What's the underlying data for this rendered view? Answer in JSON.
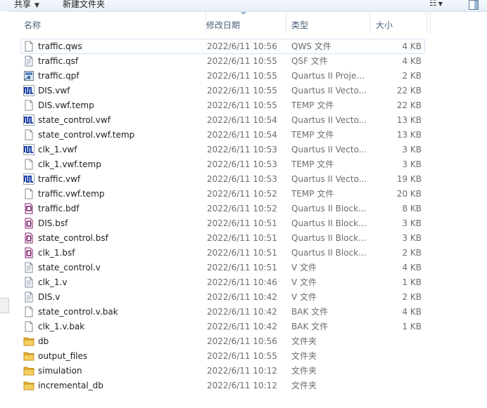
{
  "toolbar": {
    "share_label": "共享",
    "new_folder_label": "新建文件夹",
    "view_icon": "view-options-icon",
    "pane_icon": "preview-pane-icon"
  },
  "columns": {
    "name": "名称",
    "date": "修改日期",
    "type": "类型",
    "size": "大小"
  },
  "files": [
    {
      "name": "traffic.qws",
      "date": "2022/6/11 10:56",
      "type": "QWS 文件",
      "size": "4 KB",
      "icon": "blank"
    },
    {
      "name": "traffic.qsf",
      "date": "2022/6/11 10:55",
      "type": "QSF 文件",
      "size": "4 KB",
      "icon": "text"
    },
    {
      "name": "traffic.qpf",
      "date": "2022/6/11 10:55",
      "type": "Quartus II Proje...",
      "size": "2 KB",
      "icon": "project"
    },
    {
      "name": "DIS.vwf",
      "date": "2022/6/11 10:55",
      "type": "Quartus II Vecto...",
      "size": "22 KB",
      "icon": "waveform"
    },
    {
      "name": "DIS.vwf.temp",
      "date": "2022/6/11 10:55",
      "type": "TEMP 文件",
      "size": "22 KB",
      "icon": "blank"
    },
    {
      "name": "state_control.vwf",
      "date": "2022/6/11 10:54",
      "type": "Quartus II Vecto...",
      "size": "13 KB",
      "icon": "waveform"
    },
    {
      "name": "state_control.vwf.temp",
      "date": "2022/6/11 10:54",
      "type": "TEMP 文件",
      "size": "13 KB",
      "icon": "blank"
    },
    {
      "name": "clk_1.vwf",
      "date": "2022/6/11 10:53",
      "type": "Quartus II Vecto...",
      "size": "3 KB",
      "icon": "waveform"
    },
    {
      "name": "clk_1.vwf.temp",
      "date": "2022/6/11 10:53",
      "type": "TEMP 文件",
      "size": "3 KB",
      "icon": "blank"
    },
    {
      "name": "traffic.vwf",
      "date": "2022/6/11 10:53",
      "type": "Quartus II Vecto...",
      "size": "19 KB",
      "icon": "waveform"
    },
    {
      "name": "traffic.vwf.temp",
      "date": "2022/6/11 10:52",
      "type": "TEMP 文件",
      "size": "20 KB",
      "icon": "blank"
    },
    {
      "name": "traffic.bdf",
      "date": "2022/6/11 10:52",
      "type": "Quartus II Block...",
      "size": "8 KB",
      "icon": "block"
    },
    {
      "name": "DIS.bsf",
      "date": "2022/6/11 10:51",
      "type": "Quartus II Block...",
      "size": "3 KB",
      "icon": "symbol"
    },
    {
      "name": "state_control.bsf",
      "date": "2022/6/11 10:51",
      "type": "Quartus II Block...",
      "size": "3 KB",
      "icon": "symbol"
    },
    {
      "name": "clk_1.bsf",
      "date": "2022/6/11 10:51",
      "type": "Quartus II Block...",
      "size": "2 KB",
      "icon": "symbol"
    },
    {
      "name": "state_control.v",
      "date": "2022/6/11 10:51",
      "type": "V 文件",
      "size": "4 KB",
      "icon": "text"
    },
    {
      "name": "clk_1.v",
      "date": "2022/6/11 10:46",
      "type": "V 文件",
      "size": "1 KB",
      "icon": "text"
    },
    {
      "name": "DIS.v",
      "date": "2022/6/11 10:42",
      "type": "V 文件",
      "size": "2 KB",
      "icon": "text"
    },
    {
      "name": "state_control.v.bak",
      "date": "2022/6/11 10:42",
      "type": "BAK 文件",
      "size": "4 KB",
      "icon": "blank"
    },
    {
      "name": "clk_1.v.bak",
      "date": "2022/6/11 10:42",
      "type": "BAK 文件",
      "size": "1 KB",
      "icon": "blank"
    },
    {
      "name": "db",
      "date": "2022/6/11 10:56",
      "type": "文件夹",
      "size": "",
      "icon": "folder"
    },
    {
      "name": "output_files",
      "date": "2022/6/11 10:55",
      "type": "文件夹",
      "size": "",
      "icon": "folder"
    },
    {
      "name": "simulation",
      "date": "2022/6/11 10:12",
      "type": "文件夹",
      "size": "",
      "icon": "folder"
    },
    {
      "name": "incremental_db",
      "date": "2022/6/11 10:12",
      "type": "文件夹",
      "size": "",
      "icon": "folder"
    }
  ],
  "colors": {
    "header_text": "#4c607a",
    "detail_text": "#6d6d6d",
    "selection_border": "#d6e4f2",
    "folder": "#e8b63c",
    "waveform_blue": "#1a3fa8",
    "block_purple": "#7a1b6a"
  }
}
